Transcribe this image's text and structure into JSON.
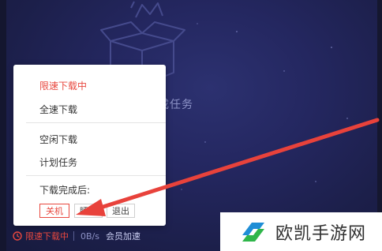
{
  "background": {
    "empty_text": "成任务"
  },
  "menu": {
    "items": [
      {
        "label": "限速下载中",
        "active": true
      },
      {
        "label": "全速下载",
        "active": false
      },
      {
        "label": "空闲下载",
        "active": false
      },
      {
        "label": "计划任务",
        "active": false
      }
    ],
    "after_label": "下载完成后:",
    "options": [
      {
        "label": "关机",
        "selected": true
      },
      {
        "label": "睡眠",
        "selected": false
      },
      {
        "label": "退出",
        "selected": false
      }
    ]
  },
  "status_bar": {
    "limit_label": "限速下载中",
    "speed": "0B/s",
    "vip_label": "会员加速"
  },
  "watermark": {
    "text": "欧凯手游网"
  },
  "colors": {
    "accent_red": "#e8483f",
    "bg_navy": "#1e2147",
    "arrow": "#e8423b"
  }
}
